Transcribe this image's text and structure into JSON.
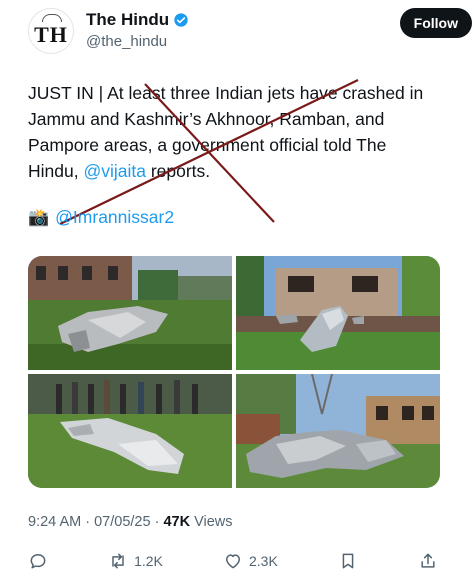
{
  "account": {
    "display_name": "The Hindu",
    "handle": "@the_hindu",
    "avatar_text": "TH"
  },
  "follow_label": "Follow",
  "tweet": {
    "text_main": "JUST IN | At least three Indian jets have crashed in Jammu and Kashmir’s Akhnoor, Ramban, and Pampore areas, a government official told The Hindu, ",
    "mention": "@vijaita",
    "text_after": " reports.",
    "photo_credit": "@Imrannissar2"
  },
  "meta": {
    "time": "9:24 AM",
    "separator": " · ",
    "date": "07/05/25",
    "views_count": "47K",
    "views_label": " Views"
  },
  "actions": {
    "reposts": "1.2K",
    "likes": "2.3K"
  },
  "colors": {
    "link": "#1d9bf0",
    "secondary": "#536471",
    "cross_line": "#7a1a1a"
  }
}
